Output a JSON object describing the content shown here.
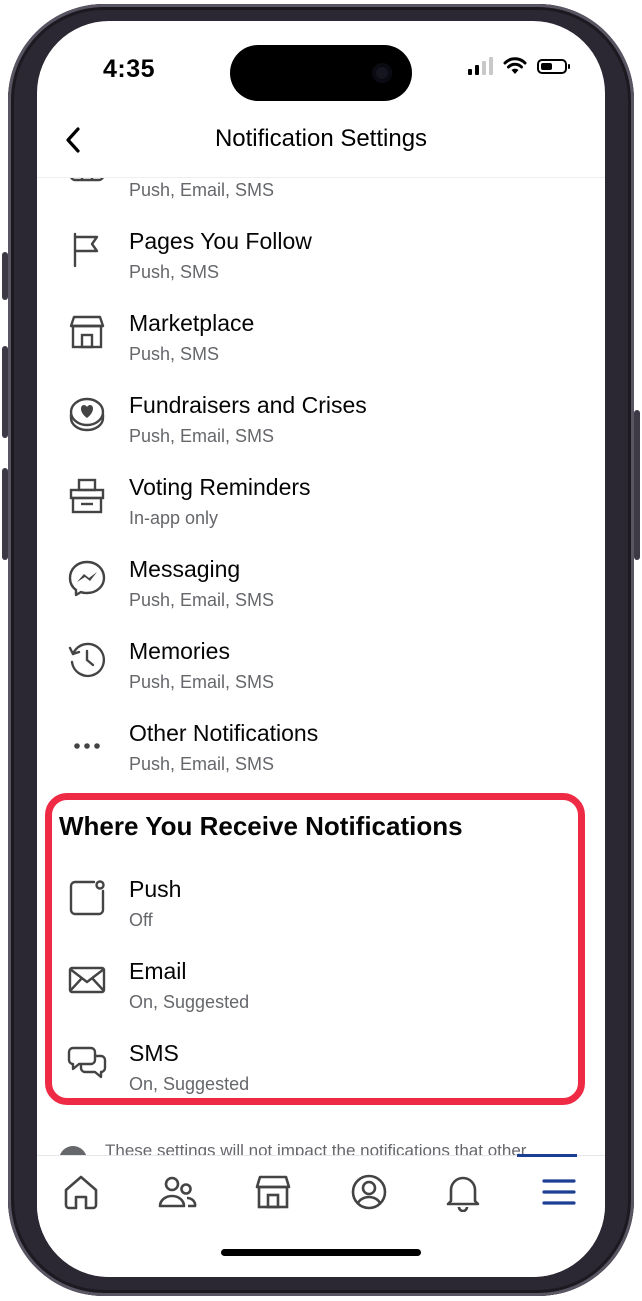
{
  "status_bar": {
    "time": "4:35"
  },
  "nav": {
    "title": "Notification Settings"
  },
  "items": [
    {
      "icon": "event-calendar-icon",
      "label": "",
      "sub": "Push, Email, SMS"
    },
    {
      "icon": "flag-icon",
      "label": "Pages You Follow",
      "sub": "Push, SMS"
    },
    {
      "icon": "storefront-icon",
      "label": "Marketplace",
      "sub": "Push, SMS"
    },
    {
      "icon": "heart-coin-icon",
      "label": "Fundraisers and Crises",
      "sub": "Push, Email, SMS"
    },
    {
      "icon": "ballot-box-icon",
      "label": "Voting Reminders",
      "sub": "In-app only"
    },
    {
      "icon": "messenger-icon",
      "label": "Messaging",
      "sub": "Push, Email, SMS"
    },
    {
      "icon": "clock-history-icon",
      "label": "Memories",
      "sub": "Push, Email, SMS"
    },
    {
      "icon": "more-dots-icon",
      "label": "Other Notifications",
      "sub": "Push, Email, SMS"
    }
  ],
  "receive_section": {
    "title": "Where You Receive Notifications",
    "items": [
      {
        "icon": "push-square-icon",
        "label": "Push",
        "sub": "Off"
      },
      {
        "icon": "envelope-icon",
        "label": "Email",
        "sub": "On, Suggested"
      },
      {
        "icon": "chat-bubbles-icon",
        "label": "SMS",
        "sub": "On, Suggested"
      }
    ]
  },
  "footnote": "These settings will not impact the notifications that other",
  "colors": {
    "highlight": "#ee2a45",
    "active_tab": "#1c3f94",
    "subtext": "#65676b"
  },
  "tabs": [
    {
      "icon": "home-icon"
    },
    {
      "icon": "friends-icon"
    },
    {
      "icon": "marketplace-icon"
    },
    {
      "icon": "profile-icon"
    },
    {
      "icon": "bell-icon"
    },
    {
      "icon": "menu-icon",
      "active": true
    }
  ]
}
